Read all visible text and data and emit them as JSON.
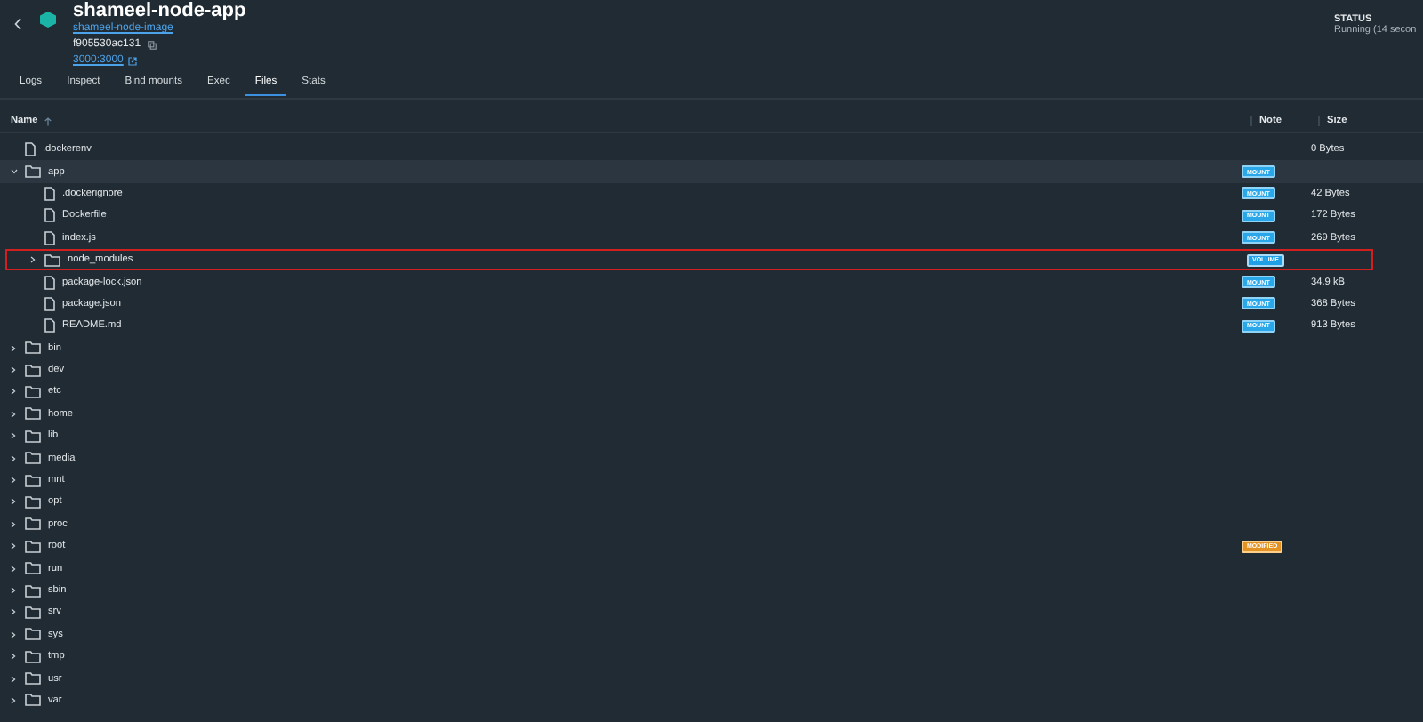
{
  "header": {
    "title": "shameel-node-app",
    "image": "shameel-node-image",
    "id": "f905530ac131",
    "ports": "3000:3000"
  },
  "status": {
    "label": "STATUS",
    "value": "Running (14 secon"
  },
  "tabs": [
    {
      "label": "Logs",
      "selected": false
    },
    {
      "label": "Inspect",
      "selected": false
    },
    {
      "label": "Bind mounts",
      "selected": false
    },
    {
      "label": "Exec",
      "selected": false
    },
    {
      "label": "Files",
      "selected": true
    },
    {
      "label": "Stats",
      "selected": false
    }
  ],
  "columns": {
    "name": "Name",
    "note": "Note",
    "size": "Size"
  },
  "files": [
    {
      "name": ".dockerenv",
      "kind": "file",
      "selected": false,
      "highlighted": false,
      "size": "0 Bytes"
    },
    {
      "name": "app",
      "kind": "folder",
      "expanded": true,
      "selected": true,
      "highlighted": false,
      "note": {
        "text": "MOUNT",
        "kind": "mount"
      },
      "children": [
        {
          "name": ".dockerignore",
          "kind": "file",
          "selected": false,
          "highlighted": false,
          "note": {
            "text": "MOUNT",
            "kind": "mount"
          },
          "size": "42 Bytes"
        },
        {
          "name": "Dockerfile",
          "kind": "file",
          "selected": false,
          "highlighted": false,
          "note": {
            "text": "MOUNT",
            "kind": "mount"
          },
          "size": "172 Bytes"
        },
        {
          "name": "index.js",
          "kind": "file",
          "selected": false,
          "highlighted": false,
          "note": {
            "text": "MOUNT",
            "kind": "mount"
          },
          "size": "269 Bytes"
        },
        {
          "name": "node_modules",
          "kind": "folder",
          "expanded": false,
          "selected": false,
          "highlighted": true,
          "note": {
            "text": "VOLUME",
            "kind": "volume"
          }
        },
        {
          "name": "package-lock.json",
          "kind": "file",
          "selected": false,
          "highlighted": false,
          "note": {
            "text": "MOUNT",
            "kind": "mount"
          },
          "size": "34.9 kB"
        },
        {
          "name": "package.json",
          "kind": "file",
          "selected": false,
          "highlighted": false,
          "note": {
            "text": "MOUNT",
            "kind": "mount"
          },
          "size": "368 Bytes"
        },
        {
          "name": "README.md",
          "kind": "file",
          "selected": false,
          "highlighted": false,
          "note": {
            "text": "MOUNT",
            "kind": "mount"
          },
          "size": "913 Bytes"
        }
      ]
    },
    {
      "name": "bin",
      "kind": "folder",
      "expanded": false,
      "selected": false,
      "highlighted": false
    },
    {
      "name": "dev",
      "kind": "folder",
      "expanded": false,
      "selected": false,
      "highlighted": false
    },
    {
      "name": "etc",
      "kind": "folder",
      "expanded": false,
      "selected": false,
      "highlighted": false
    },
    {
      "name": "home",
      "kind": "folder",
      "expanded": false,
      "selected": false,
      "highlighted": false
    },
    {
      "name": "lib",
      "kind": "folder",
      "expanded": false,
      "selected": false,
      "highlighted": false
    },
    {
      "name": "media",
      "kind": "folder",
      "expanded": false,
      "selected": false,
      "highlighted": false
    },
    {
      "name": "mnt",
      "kind": "folder",
      "expanded": false,
      "selected": false,
      "highlighted": false
    },
    {
      "name": "opt",
      "kind": "folder",
      "expanded": false,
      "selected": false,
      "highlighted": false
    },
    {
      "name": "proc",
      "kind": "folder",
      "expanded": false,
      "selected": false,
      "highlighted": false
    },
    {
      "name": "root",
      "kind": "folder",
      "expanded": false,
      "selected": false,
      "highlighted": false,
      "note": {
        "text": "MODIFIED",
        "kind": "modified"
      }
    },
    {
      "name": "run",
      "kind": "folder",
      "expanded": false,
      "selected": false,
      "highlighted": false
    },
    {
      "name": "sbin",
      "kind": "folder",
      "expanded": false,
      "selected": false,
      "highlighted": false
    },
    {
      "name": "srv",
      "kind": "folder",
      "expanded": false,
      "selected": false,
      "highlighted": false
    },
    {
      "name": "sys",
      "kind": "folder",
      "expanded": false,
      "selected": false,
      "highlighted": false
    },
    {
      "name": "tmp",
      "kind": "folder",
      "expanded": false,
      "selected": false,
      "highlighted": false
    },
    {
      "name": "usr",
      "kind": "folder",
      "expanded": false,
      "selected": false,
      "highlighted": false
    },
    {
      "name": "var",
      "kind": "folder",
      "expanded": false,
      "selected": false,
      "highlighted": false
    }
  ]
}
